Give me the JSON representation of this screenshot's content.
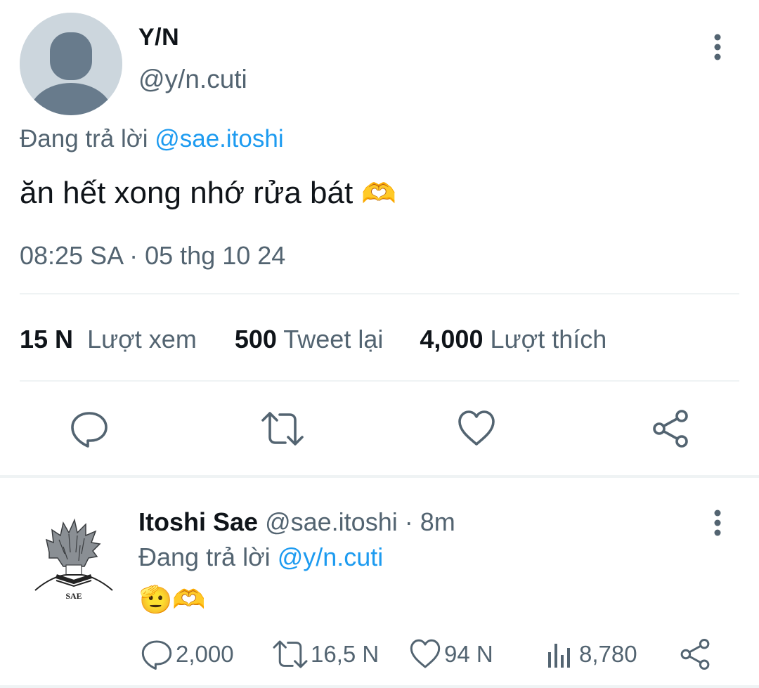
{
  "main_tweet": {
    "name": "Y/N",
    "handle": "@y/n.cuti",
    "replying_prefix": "Đang trả lời",
    "replying_to": "@sae.itoshi",
    "text": "ăn hết xong nhớ rửa bát",
    "text_emoji": "🫶",
    "timestamp": "08:25 SA · 05 thg 10 24",
    "stats": {
      "views_count": "15 N",
      "views_label": "Lượt xem",
      "retweets_count": "500",
      "retweets_label": "Tweet lại",
      "likes_count": "4,000",
      "likes_label": "Lượt thích"
    },
    "actions": [
      "reply-icon",
      "retweet-icon",
      "like-icon",
      "share-icon"
    ]
  },
  "reply_tweet": {
    "name": "Itoshi Sae",
    "handle": "@sae.itoshi",
    "time": "· 8m",
    "replying_prefix": "Đang trả lời",
    "replying_to": "@y/n.cuti",
    "text_emoji": "🫡🫶",
    "avatar_caption": "SAE",
    "replies": "2,000",
    "retweets": "16,5 N",
    "likes": "94 N",
    "views": "8,780"
  },
  "colors": {
    "accent": "#1d9bf0",
    "muted": "#536471",
    "text": "#0f1419",
    "divider": "#eff3f4",
    "avatar_placeholder": "#ccd6dd",
    "avatar_silhouette": "#687b8c"
  }
}
